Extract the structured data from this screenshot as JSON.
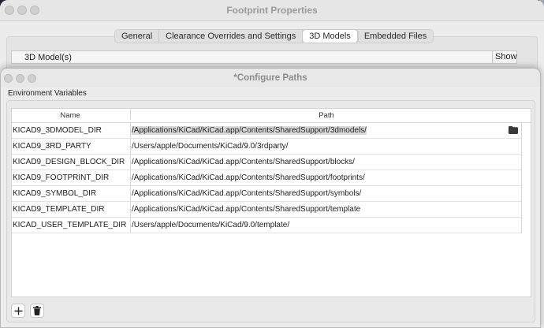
{
  "footprint_window": {
    "title": "Footprint Properties",
    "tabs": [
      {
        "label": "General",
        "active": false
      },
      {
        "label": "Clearance Overrides and Settings",
        "active": false
      },
      {
        "label": "3D Models",
        "active": true
      },
      {
        "label": "Embedded Files",
        "active": false
      }
    ],
    "model_table": {
      "col_model": "3D Model(s)",
      "col_show": "Show"
    }
  },
  "configure_paths": {
    "title": "*Configure Paths",
    "section_label": "Environment Variables",
    "columns": {
      "name": "Name",
      "path": "Path"
    },
    "rows": [
      {
        "name": "KICAD9_3DMODEL_DIR",
        "path": "/Applications/KiCad/KiCad.app/Contents/SharedSupport/3dmodels/",
        "selected": true
      },
      {
        "name": "KICAD9_3RD_PARTY",
        "path": "/Users/apple/Documents/KiCad/9.0/3rdparty/"
      },
      {
        "name": "KICAD9_DESIGN_BLOCK_DIR",
        "path": "/Applications/KiCad/KiCad.app/Contents/SharedSupport/blocks/"
      },
      {
        "name": "KICAD9_FOOTPRINT_DIR",
        "path": "/Applications/KiCad/KiCad.app/Contents/SharedSupport/footprints/"
      },
      {
        "name": "KICAD9_SYMBOL_DIR",
        "path": "/Applications/KiCad/KiCad.app/Contents/SharedSupport/symbols/"
      },
      {
        "name": "KICAD9_TEMPLATE_DIR",
        "path": "/Applications/KiCad/KiCad.app/Contents/SharedSupport/template"
      },
      {
        "name": "KICAD_USER_TEMPLATE_DIR",
        "path": "/Users/apple/Documents/KiCad/9.0/template/"
      }
    ],
    "buttons": {
      "add_icon": "plus-icon",
      "delete_icon": "trash-icon",
      "browse_icon": "folder-icon"
    }
  },
  "colors": {
    "window_bg": "#ececec",
    "selection": "#d9d9d9",
    "desktop": "#1b2433"
  }
}
